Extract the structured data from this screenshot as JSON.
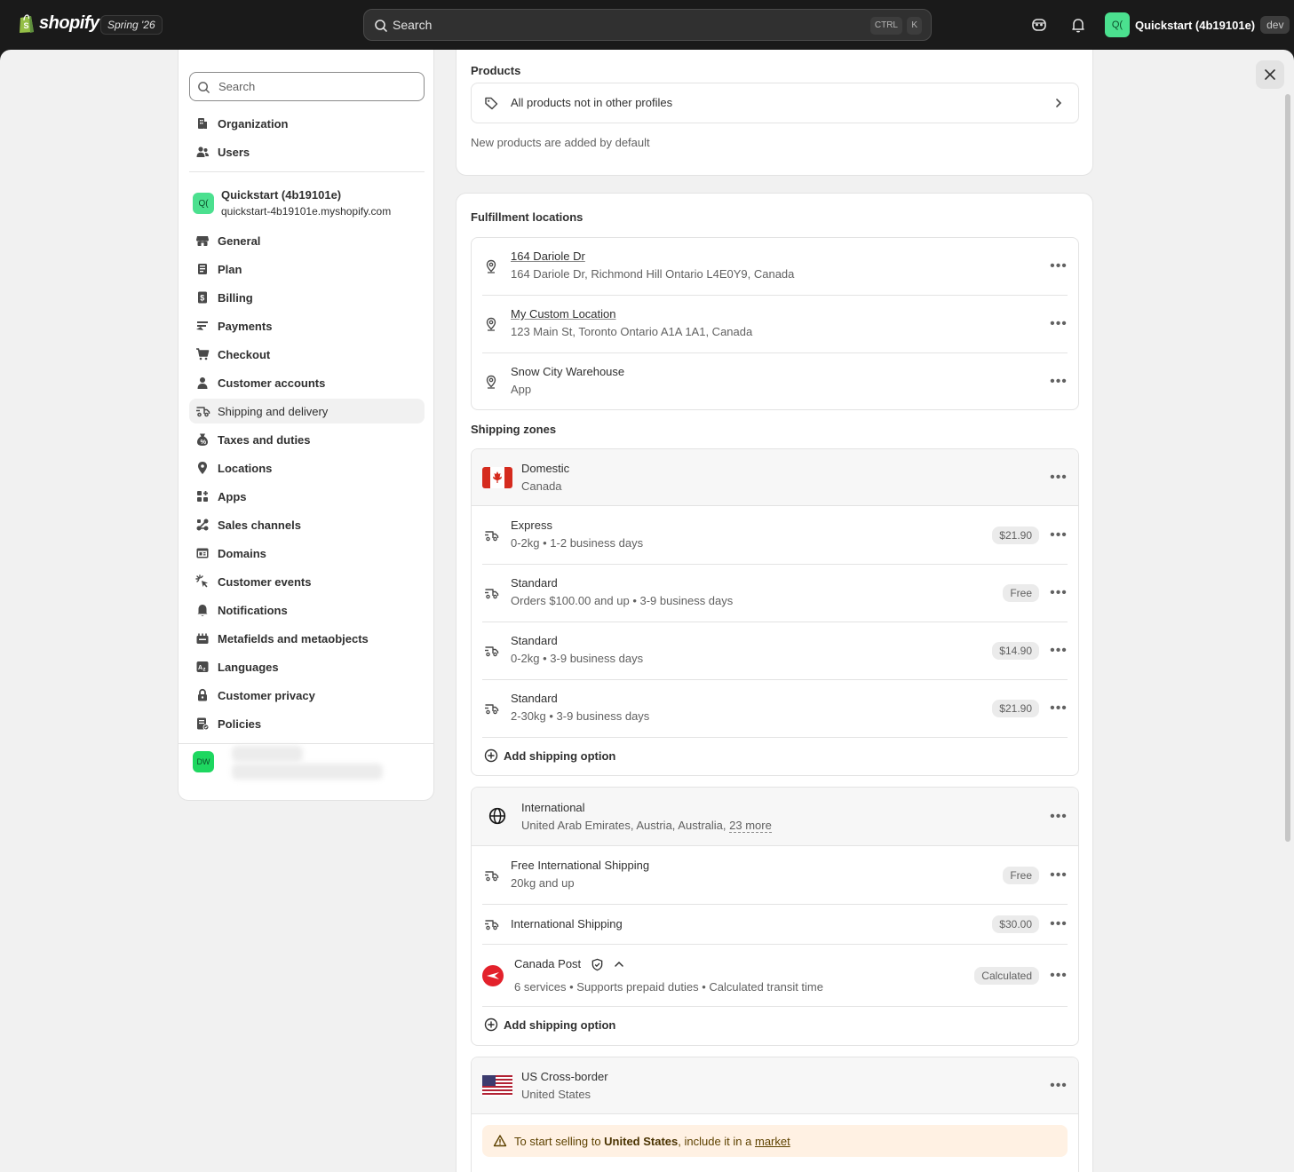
{
  "topbar": {
    "brand": "shopify",
    "edition": "Spring '26",
    "search_placeholder": "Search",
    "shortcut_ctrl": "CTRL",
    "shortcut_key": "K",
    "store_initials": "Q(",
    "store_name": "Quickstart (4b19101e)",
    "env_badge": "dev"
  },
  "sidebar": {
    "search_placeholder": "Search",
    "org_items": [
      {
        "label": "Organization",
        "icon": "building-icon"
      },
      {
        "label": "Users",
        "icon": "users-icon"
      }
    ],
    "store": {
      "initials": "Q(",
      "name": "Quickstart (4b19101e)",
      "domain": "quickstart-4b19101e.myshopify.com"
    },
    "items": [
      {
        "label": "General",
        "icon": "store-icon"
      },
      {
        "label": "Plan",
        "icon": "plan-icon"
      },
      {
        "label": "Billing",
        "icon": "billing-icon"
      },
      {
        "label": "Payments",
        "icon": "payments-icon"
      },
      {
        "label": "Checkout",
        "icon": "cart-icon"
      },
      {
        "label": "Customer accounts",
        "icon": "person-icon"
      },
      {
        "label": "Shipping and delivery",
        "icon": "truck-icon",
        "active": true
      },
      {
        "label": "Taxes and duties",
        "icon": "tax-icon"
      },
      {
        "label": "Locations",
        "icon": "location-icon"
      },
      {
        "label": "Apps",
        "icon": "apps-icon"
      },
      {
        "label": "Sales channels",
        "icon": "channels-icon"
      },
      {
        "label": "Domains",
        "icon": "domains-icon"
      },
      {
        "label": "Customer events",
        "icon": "cursor-icon"
      },
      {
        "label": "Notifications",
        "icon": "bell-icon"
      },
      {
        "label": "Metafields and metaobjects",
        "icon": "metafields-icon"
      },
      {
        "label": "Languages",
        "icon": "language-icon"
      },
      {
        "label": "Customer privacy",
        "icon": "lock-icon"
      },
      {
        "label": "Policies",
        "icon": "policies-icon"
      }
    ],
    "user_initials": "DW"
  },
  "products_card": {
    "title": "Products",
    "item": "All products not in other profiles",
    "note": "New products are added by default"
  },
  "fulfillment": {
    "title": "Fulfillment locations",
    "locations": [
      {
        "name": "164 Dariole Dr",
        "address": "164 Dariole Dr, Richmond Hill Ontario L4E0Y9, Canada",
        "link": true
      },
      {
        "name": "My Custom Location",
        "address": "123 Main St, Toronto Ontario A1A 1A1, Canada",
        "link": true
      },
      {
        "name": "Snow City Warehouse",
        "address": "App",
        "link": false
      }
    ]
  },
  "zones": {
    "title": "Shipping zones",
    "domestic": {
      "name": "Domestic",
      "region": "Canada",
      "options": [
        {
          "name": "Express",
          "detail": "0-2kg • 1-2 business days",
          "price": "$21.90"
        },
        {
          "name": "Standard",
          "detail": "Orders $100.00 and up • 3-9 business days",
          "price": "Free"
        },
        {
          "name": "Standard",
          "detail": "0-2kg • 3-9 business days",
          "price": "$14.90"
        },
        {
          "name": "Standard",
          "detail": "2-30kg • 3-9 business days",
          "price": "$21.90"
        }
      ],
      "add_label": "Add shipping option"
    },
    "international": {
      "name": "International",
      "region": "United Arab Emirates, Austria, Australia,",
      "more": "23 more",
      "options": [
        {
          "name": "Free International Shipping",
          "detail": "20kg and up",
          "price": "Free"
        },
        {
          "name": "International Shipping",
          "detail": "",
          "price": "$30.00"
        }
      ],
      "carrier": {
        "name": "Canada Post",
        "detail": "6 services • Supports prepaid duties • Calculated transit time",
        "price": "Calculated"
      },
      "add_label": "Add shipping option"
    },
    "us": {
      "name": "US Cross-border",
      "region": "United States",
      "warning_pre": "To start selling to",
      "warning_country": "United States",
      "warning_mid": ", include it in a",
      "warning_link": "market"
    }
  },
  "colors": {
    "topbar": "#1a1a1a",
    "canvas": "#f1f1f1",
    "card": "#ffffff",
    "store_avatar": "#4be08f",
    "warning_bg": "#fff1e3"
  }
}
